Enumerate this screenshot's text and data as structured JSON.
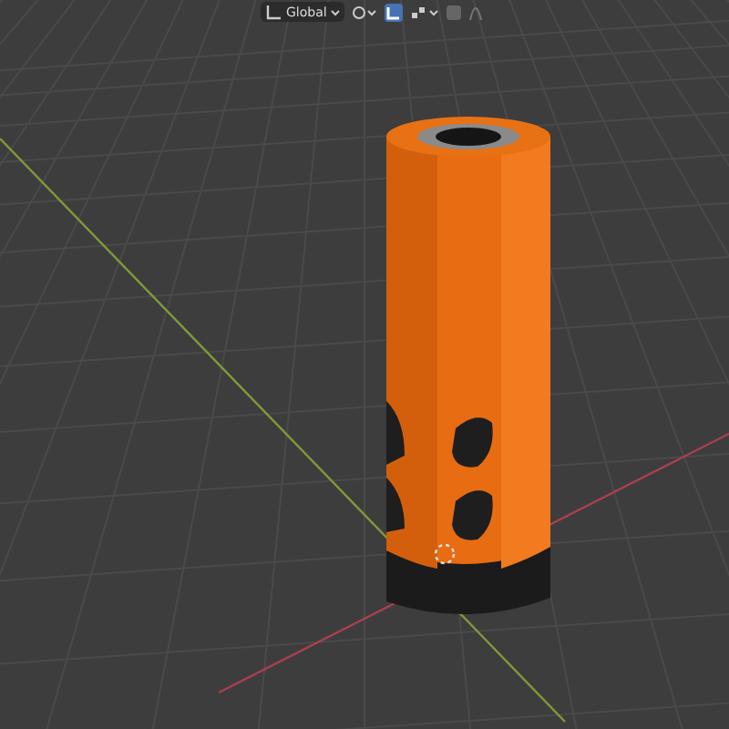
{
  "header": {
    "orientation": "Global",
    "snap": {
      "on": true
    }
  }
}
